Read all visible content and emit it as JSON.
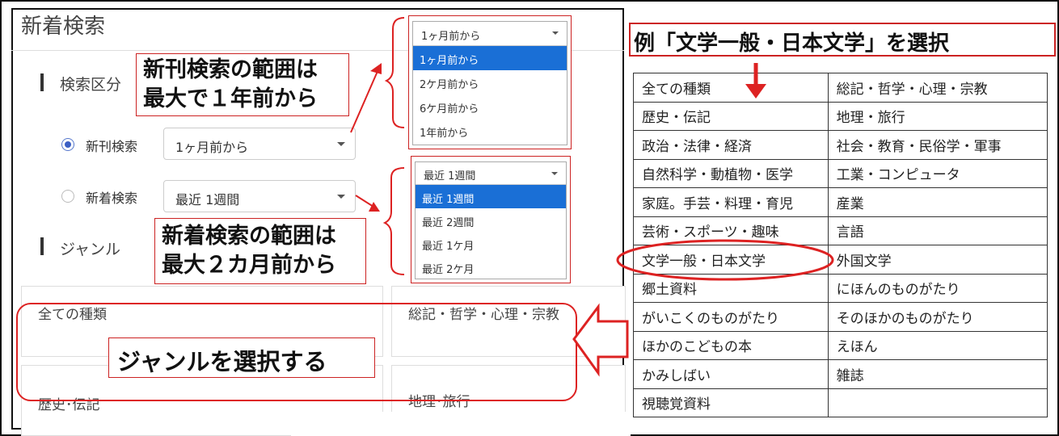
{
  "screen": {
    "title": "新着検索",
    "section_kubun": "検索区分",
    "section_genre": "ジャンル",
    "radios": [
      {
        "label": "新刊検索",
        "checked": true,
        "select_value": "1ヶ月前から"
      },
      {
        "label": "新着検索",
        "checked": false,
        "select_value": "最近 1週間"
      }
    ],
    "genre_cards": [
      "全ての種類",
      "総記・哲学・心理・宗教",
      "歴史･伝記",
      "地理･旅行"
    ]
  },
  "dropdown_shinkan": {
    "current": "1ヶ月前から",
    "options": [
      "1ヶ月前から",
      "2ケ月前から",
      "6ケ月前から",
      "1年前から"
    ],
    "selected_index": 0
  },
  "dropdown_shinchaku": {
    "current": "最近 1週間",
    "options": [
      "最近 1週間",
      "最近 2週間",
      "最近 1ケ月",
      "最近 2ケ月"
    ],
    "selected_index": 0
  },
  "callouts": {
    "shinkan_line1": "新刊検索の範囲は",
    "shinkan_line2": "最大で１年前から",
    "shinchaku_line1": "新着検索の範囲は",
    "shinchaku_line2": "最大２カ月前から",
    "genre": "ジャンルを選択する"
  },
  "example": {
    "title": "例「文学一般・日本文学」を選択",
    "highlighted": "文学一般・日本文学",
    "rows": [
      [
        "全ての種類",
        "総記・哲学・心理・宗教"
      ],
      [
        "歴史・伝記",
        "地理・旅行"
      ],
      [
        "政治・法律・経済",
        "社会・教育・民俗学・軍事"
      ],
      [
        "自然科学・動植物・医学",
        "工業・コンピュータ"
      ],
      [
        "家庭。手芸・料理・育児",
        "産業"
      ],
      [
        "芸術・スポーツ・趣味",
        "言語"
      ],
      [
        "文学一般・日本文学",
        "外国文学"
      ],
      [
        "郷土資料",
        "にほんのものがたり"
      ],
      [
        "がいこくのものがたり",
        "そのほかのものがたり"
      ],
      [
        "ほかのこどもの本",
        "えほん"
      ],
      [
        "かみしばい",
        "雑誌"
      ],
      [
        "視聴覚資料",
        ""
      ]
    ]
  },
  "colors": {
    "annotation_red": "#dd2222",
    "selected_blue": "#1a6fd6"
  }
}
